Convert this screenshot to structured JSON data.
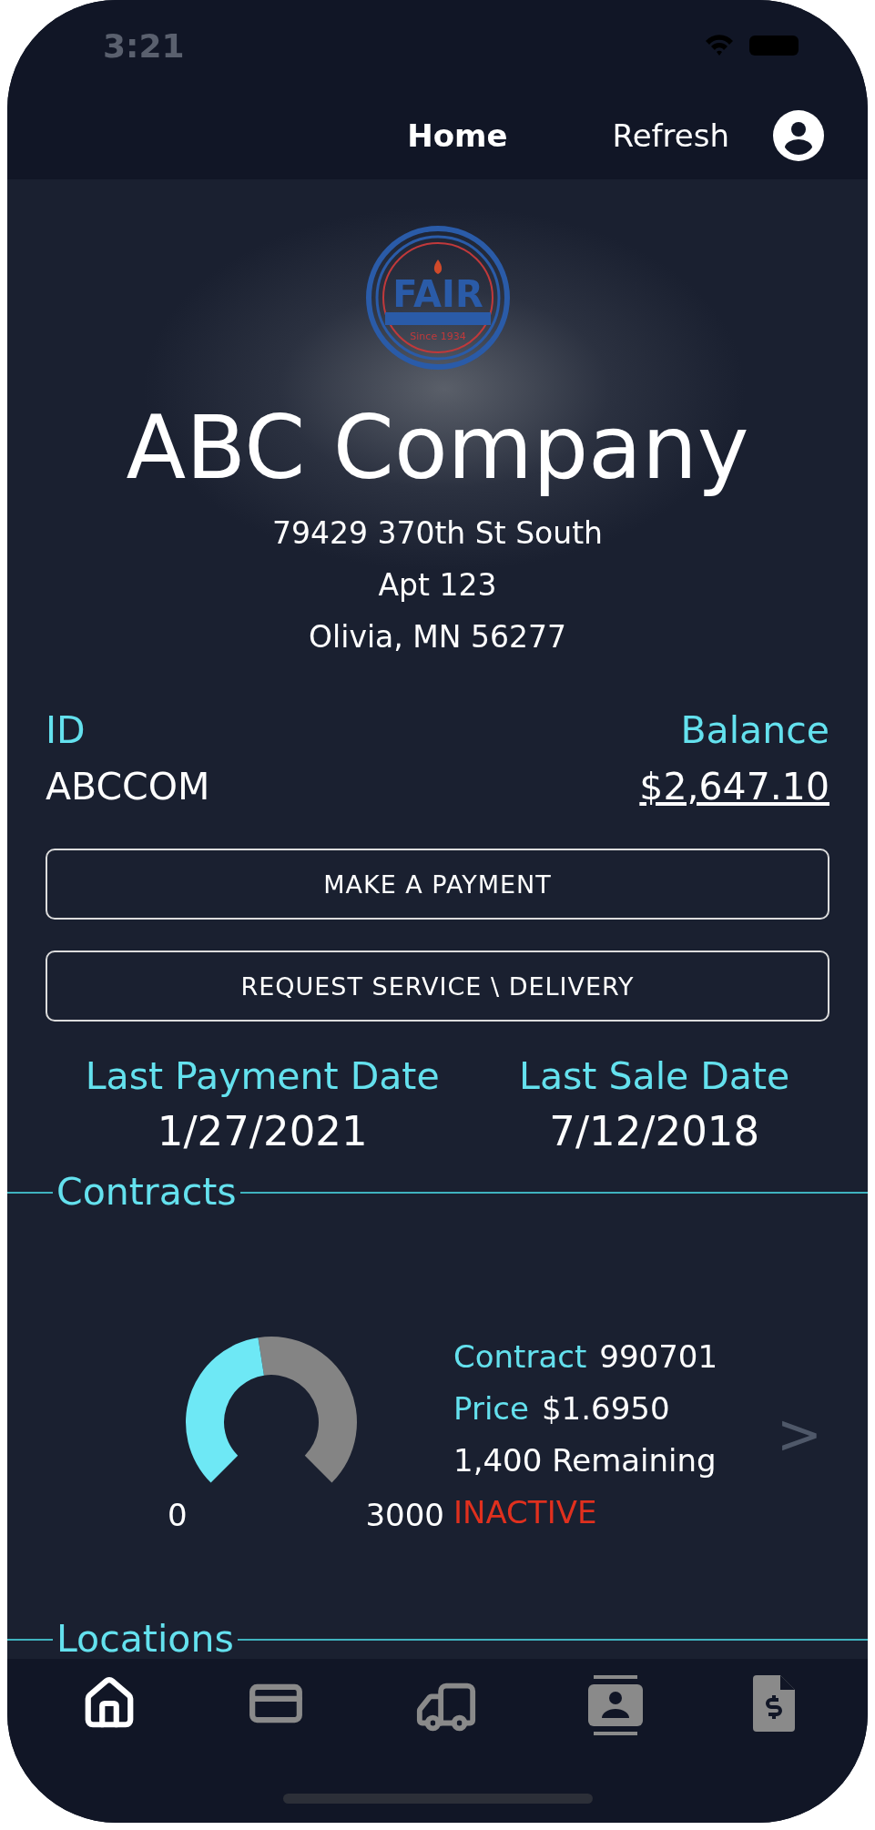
{
  "status_bar": {
    "time": "3:21"
  },
  "top_nav": {
    "items": [
      {
        "label": "Home",
        "selected": true
      },
      {
        "label": "Refresh",
        "selected": false
      }
    ]
  },
  "logo": {
    "name": "FAIR",
    "since": "Since 1934"
  },
  "company": {
    "name": "ABC Company",
    "address": [
      "79429 370th St South",
      "Apt 123",
      "Olivia, MN 56277"
    ]
  },
  "account": {
    "id_label": "ID",
    "id": "ABCCOM",
    "balance_label": "Balance",
    "balance": "$2,647.10"
  },
  "buttons": [
    "MAKE A PAYMENT",
    "REQUEST SERVICE \\ DELIVERY"
  ],
  "dates": [
    {
      "label": "Last Payment Date",
      "value": "1/27/2021"
    },
    {
      "label": "Last Sale Date",
      "value": "7/12/2018"
    }
  ],
  "contracts": {
    "title": "Contracts",
    "gauge": {
      "level": 0.467,
      "min": "0",
      "max": "3000"
    },
    "contract_label": "Contract",
    "contract": "990701",
    "price_label": "Price",
    "price": "$1.6950",
    "remaining": "1,400 Remaining",
    "status": "INACTIVE",
    "chevron": ">"
  },
  "locations": {
    "title": "Locations"
  },
  "bottom_tabs": [
    {
      "kind": "home",
      "selected": true
    },
    {
      "kind": "card",
      "selected": false
    },
    {
      "kind": "truck",
      "selected": false
    },
    {
      "kind": "contact",
      "selected": false
    },
    {
      "kind": "invoice",
      "selected": false
    }
  ]
}
